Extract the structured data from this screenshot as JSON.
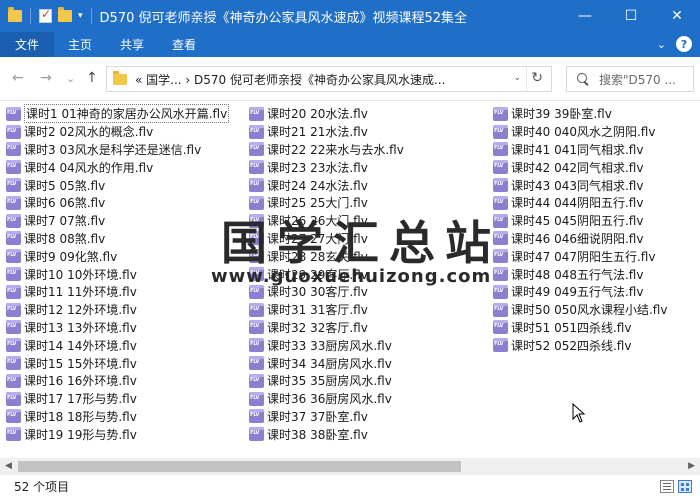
{
  "window": {
    "title": "D570 倪可老师亲授《神奇办公家具风水速成》视频课程52集全",
    "controls": {
      "minimize": "—",
      "maximize": "☐",
      "close": "✕"
    }
  },
  "ribbon": {
    "tabs": [
      "文件",
      "主页",
      "共享",
      "查看"
    ],
    "expand_glyph": "⌄",
    "help_glyph": "?"
  },
  "nav": {
    "back_glyph": "←",
    "forward_glyph": "→",
    "recent_glyph": "⌄",
    "up_glyph": "↑",
    "address": "«  国学...  ›  D570 倪可老师亲授《神奇办公家具风水速成...",
    "address_dropdown_glyph": "⌄",
    "refresh_glyph": "↻",
    "search_placeholder": "搜索\"D570 ..."
  },
  "files": {
    "columns": [
      [
        "课时1 01神奇的家居办公风水开篇.flv",
        "课时2 02风水的概念.flv",
        "课时3 03风水是科学还是迷信.flv",
        "课时4 04风水的作用.flv",
        "课时5 05煞.flv",
        "课时6 06煞.flv",
        "课时7 07煞.flv",
        "课时8 08煞.flv",
        "课时9 09化煞.flv",
        "课时10 10外环境.flv",
        "课时11 11外环境.flv",
        "课时12 12外环境.flv",
        "课时13 13外环境.flv",
        "课时14 14外环境.flv",
        "课时15 15外环境.flv",
        "课时16 16外环境.flv",
        "课时17 17形与势.flv",
        "课时18 18形与势.flv",
        "课时19 19形与势.flv"
      ],
      [
        "课时20 20水法.flv",
        "课时21 21水法.flv",
        "课时22 22来水与去水.flv",
        "课时23 23水法.flv",
        "课时24 24水法.flv",
        "课时25 25大门.flv",
        "课时26 26大门.flv",
        "课时27 27大门.flv",
        "课时28 28玄关.flv",
        "课时29 29客厅.flv",
        "课时30 30客厅.flv",
        "课时31 31客厅.flv",
        "课时32 32客厅.flv",
        "课时33 33厨房风水.flv",
        "课时34 34厨房风水.flv",
        "课时35 35厨房风水.flv",
        "课时36 36厨房风水.flv",
        "课时37 37卧室.flv",
        "课时38 38卧室.flv"
      ],
      [
        "课时39 39卧室.flv",
        "课时40 040风水之阴阳.flv",
        "课时41 041同气相求.flv",
        "课时42 042同气相求.flv",
        "课时43 043同气相求.flv",
        "课时44 044阴阳五行.flv",
        "课时45 045阴阳五行.flv",
        "课时46 046细说阴阳.flv",
        "课时47 047阴阳生五行.flv",
        "课时48 048五行气法.flv",
        "课时49 049五行气法.flv",
        "课时50 050风水课程小结.flv",
        "课时51 051四杀线.flv",
        "课时52 052四杀线.flv"
      ]
    ],
    "selected_index": 0
  },
  "watermark": {
    "title": "国学汇总站",
    "url": "www.guoxuehuizong.com"
  },
  "scroll": {
    "left_glyph": "◀",
    "right_glyph": "▶"
  },
  "status": {
    "count_text": "52 个项目"
  }
}
